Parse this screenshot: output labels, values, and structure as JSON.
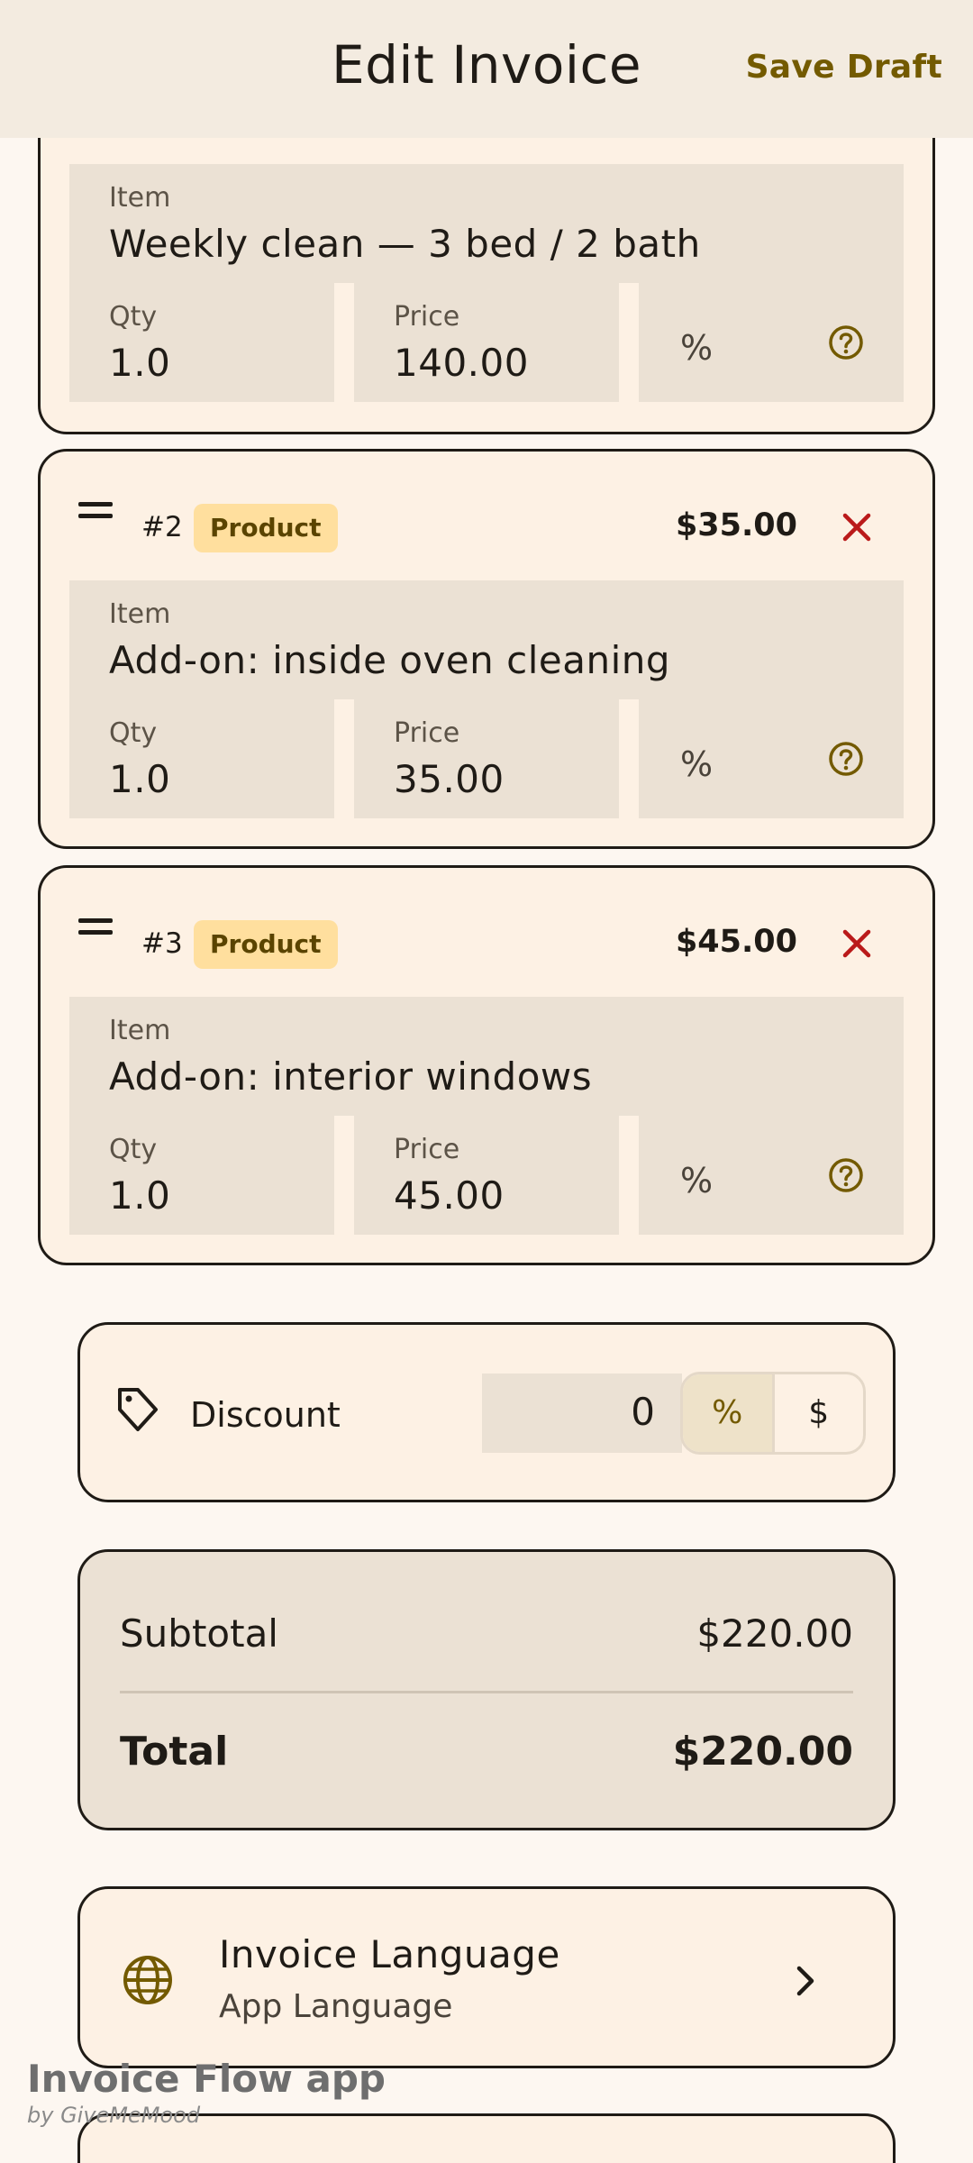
{
  "appbar": {
    "title": "Edit Invoice",
    "save_label": "Save Draft"
  },
  "items": [
    {
      "item_label": "Item",
      "item_value": "Weekly clean — 3 bed / 2 bath",
      "qty_label": "Qty",
      "qty_value": "1.0",
      "price_label": "Price",
      "price_value": "140.00",
      "tax_symbol": "%"
    },
    {
      "number": "#2",
      "type": "Product",
      "line_total": "$35.00",
      "item_label": "Item",
      "item_value": "Add-on: inside oven cleaning",
      "qty_label": "Qty",
      "qty_value": "1.0",
      "price_label": "Price",
      "price_value": "35.00",
      "tax_symbol": "%"
    },
    {
      "number": "#3",
      "type": "Product",
      "line_total": "$45.00",
      "item_label": "Item",
      "item_value": "Add-on: interior windows",
      "qty_label": "Qty",
      "qty_value": "1.0",
      "price_label": "Price",
      "price_value": "45.00",
      "tax_symbol": "%"
    }
  ],
  "discount": {
    "label": "Discount",
    "value": "0",
    "mode_percent": "%",
    "mode_amount": "$",
    "selected": "%"
  },
  "totals": {
    "subtotal_label": "Subtotal",
    "subtotal_value": "$220.00",
    "total_label": "Total",
    "total_value": "$220.00"
  },
  "language": {
    "title": "Invoice Language",
    "value": "App Language"
  },
  "watermark": {
    "line1": "Invoice Flow app",
    "line2": "by GiveMeMood"
  },
  "colors": {
    "accent": "#735a00",
    "remove": "#ba1a1a",
    "chip_bg": "#ffdf9e",
    "field_bg": "#ebe1d4",
    "card_bg": "#fdf1e4"
  },
  "icons": [
    "drag-handle-icon",
    "close-icon",
    "help-icon",
    "tag-icon",
    "globe-icon",
    "chevron-right-icon"
  ]
}
